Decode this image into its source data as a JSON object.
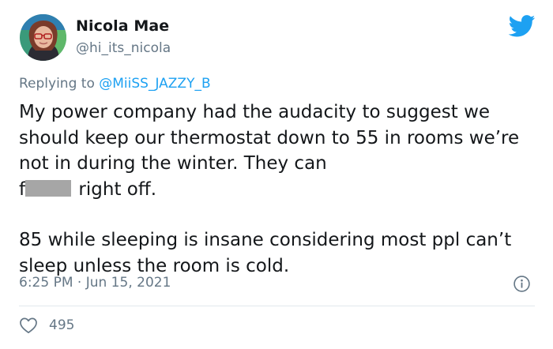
{
  "author": {
    "display_name": "Nicola Mae",
    "handle": "@hi_its_nicola"
  },
  "reply": {
    "prefix": "Replying to ",
    "target": "@MiiSS_JAZZY_B"
  },
  "tweet": {
    "line_1": "My power company had the audacity to suggest we should keep our thermostat down to 55 in rooms we’re not in during the winter. They can",
    "line_1_start": "f",
    "line_1_end": " right off.",
    "paragraph_2": "85 while sleeping is insane considering most ppl can’t sleep unless the room is cold."
  },
  "meta": {
    "time": "6:25 PM",
    "separator": " · ",
    "date": "Jun 15, 2021"
  },
  "engagement": {
    "likes": "495"
  },
  "icons": {
    "brand": "twitter-bird-icon",
    "info": "info-icon",
    "like": "heart-icon"
  },
  "colors": {
    "brand_blue": "#1da1f2",
    "secondary_text": "#657786",
    "primary_text": "#14171a",
    "divider": "#e1e8ed",
    "redaction": "#a6a6a6"
  }
}
